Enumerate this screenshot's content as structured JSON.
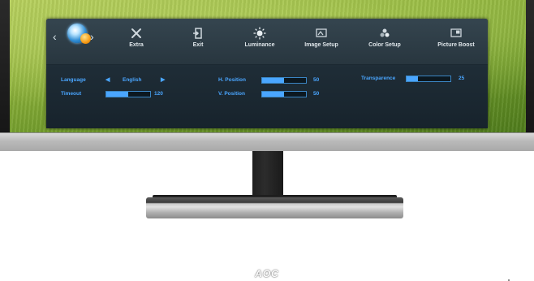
{
  "brand": {
    "logo": "AOC"
  },
  "menu": {
    "items": [
      {
        "label": "",
        "icon": "language-globe-icon"
      },
      {
        "label": "Extra",
        "icon": "extra-tools-icon"
      },
      {
        "label": "Exit",
        "icon": "exit-door-icon"
      },
      {
        "label": "Luminance",
        "icon": "sun-brightness-icon"
      },
      {
        "label": "Image Setup",
        "icon": "image-setup-icon"
      },
      {
        "label": "Color Setup",
        "icon": "color-setup-icon"
      },
      {
        "label": "Picture Boost",
        "icon": "picture-boost-icon"
      }
    ],
    "selected_index": 0
  },
  "settings": {
    "language": {
      "label": "Language",
      "value": "English"
    },
    "timeout": {
      "label": "Timeout",
      "value": "120",
      "level": 0.5
    },
    "h_position": {
      "label": "H. Position",
      "value": "50",
      "level": 0.5
    },
    "v_position": {
      "label": "V. Position",
      "value": "50",
      "level": 0.5
    },
    "transparence": {
      "label": "Transparence",
      "value": "25",
      "level": 0.25
    }
  },
  "colors": {
    "osd_text": "#4aa6ff",
    "osd_background": "#1b2832",
    "menu_text": "#dfe6ea"
  }
}
